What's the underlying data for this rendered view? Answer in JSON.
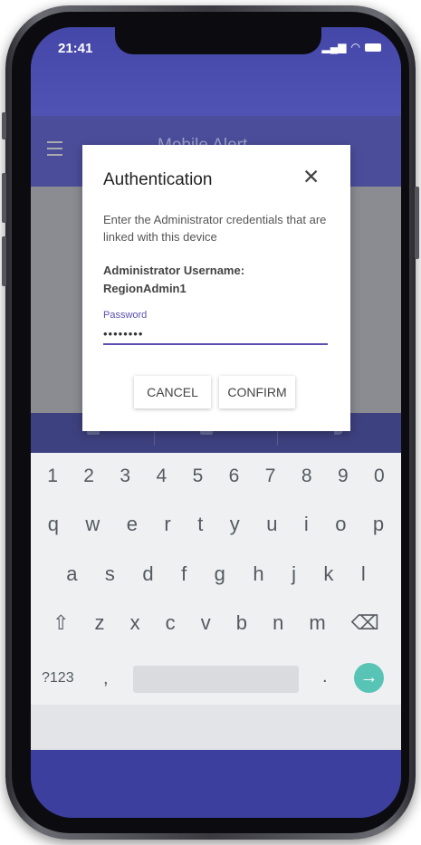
{
  "status_bar": {
    "time": "21:41",
    "signal_icon": "signal-icon",
    "wifi_icon": "wifi-icon",
    "battery_icon": "battery-icon"
  },
  "app_bar": {
    "title": "Mobile Alert"
  },
  "dialog": {
    "title": "Authentication",
    "close_icon": "close-icon",
    "message": "Enter the Administrator credentials that are linked with this device",
    "username_label": "Administrator Username:",
    "username_value": "RegionAdmin1",
    "password_label": "Password",
    "password_value": "••••••••",
    "cancel_label": "CANCEL",
    "confirm_label": "CONFIRM"
  },
  "keyboard": {
    "numbers": [
      "1",
      "2",
      "3",
      "4",
      "5",
      "6",
      "7",
      "8",
      "9",
      "0"
    ],
    "row1": [
      "q",
      "w",
      "e",
      "r",
      "t",
      "y",
      "u",
      "i",
      "o",
      "p"
    ],
    "row2": [
      "a",
      "s",
      "d",
      "f",
      "g",
      "h",
      "j",
      "k",
      "l"
    ],
    "row3": [
      "z",
      "x",
      "c",
      "v",
      "b",
      "n",
      "m"
    ],
    "symbols_key": "?123",
    "comma_key": ",",
    "period_key": ".",
    "shift_icon": "shift-icon",
    "backspace_icon": "backspace-icon",
    "enter_icon": "arrow-right-icon"
  },
  "colors": {
    "primary": "#4447a8",
    "accent": "#5a4fb0",
    "enter_key": "#58c4b5"
  }
}
